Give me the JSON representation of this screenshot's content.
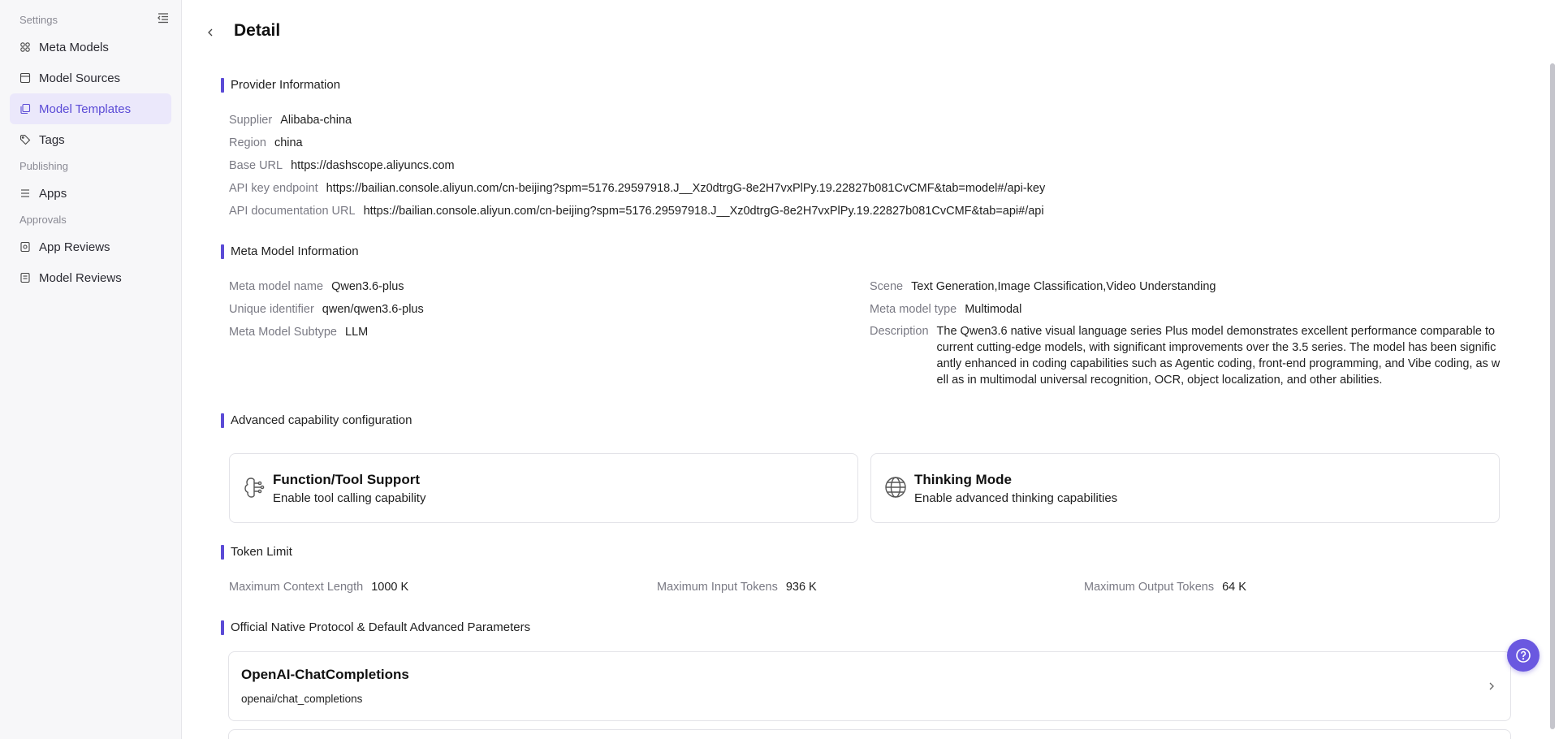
{
  "sidebar": {
    "settings_label": "Settings",
    "publishing_label": "Publishing",
    "approvals_label": "Approvals",
    "items": [
      {
        "label": "Meta Models",
        "icon": "meta-models-icon"
      },
      {
        "label": "Model Sources",
        "icon": "model-sources-icon"
      },
      {
        "label": "Model Templates",
        "icon": "model-templates-icon",
        "active": true
      },
      {
        "label": "Tags",
        "icon": "tag-icon"
      },
      {
        "label": "Apps",
        "icon": "apps-icon"
      },
      {
        "label": "App Reviews",
        "icon": "app-reviews-icon"
      },
      {
        "label": "Model Reviews",
        "icon": "model-reviews-icon"
      }
    ]
  },
  "header": {
    "title": "Detail"
  },
  "provider": {
    "section_title": "Provider Information",
    "supplier_label": "Supplier",
    "supplier": "Alibaba-china",
    "region_label": "Region",
    "region": "china",
    "base_url_label": "Base URL",
    "base_url": "https://dashscope.aliyuncs.com",
    "api_key_label": "API key endpoint",
    "api_key": "https://bailian.console.aliyun.com/cn-beijing?spm=5176.29597918.J__Xz0dtrgG-8e2H7vxPlPy.19.22827b081CvCMF&tab=model#/api-key",
    "api_doc_label": "API documentation URL",
    "api_doc": "https://bailian.console.aliyun.com/cn-beijing?spm=5176.29597918.J__Xz0dtrgG-8e2H7vxPlPy.19.22827b081CvCMF&tab=api#/api"
  },
  "meta_model": {
    "section_title": "Meta Model Information",
    "name_label": "Meta model name",
    "name": "Qwen3.6-plus",
    "uid_label": "Unique identifier",
    "uid": "qwen/qwen3.6-plus",
    "subtype_label": "Meta Model Subtype",
    "subtype": "LLM",
    "scene_label": "Scene",
    "scene": "Text Generation,Image Classification,Video Understanding",
    "type_label": "Meta model type",
    "type": "Multimodal",
    "desc_label": "Description",
    "desc": "The Qwen3.6 native visual language series Plus model demonstrates excellent performance comparable to current cutting-edge models, with significant improvements over the 3.5 series. The model has been significantly enhanced in coding capabilities such as Agentic coding, front-end programming, and Vibe coding, as well as in multimodal universal recognition, OCR, object localization, and other abilities."
  },
  "capabilities": {
    "section_title": "Advanced capability configuration",
    "tool_title": "Function/Tool Support",
    "tool_desc": "Enable tool calling capability",
    "thinking_title": "Thinking Mode",
    "thinking_desc": "Enable advanced thinking capabilities"
  },
  "tokens": {
    "section_title": "Token Limit",
    "ctx_label": "Maximum Context Length",
    "ctx": "1000 K",
    "input_label": "Maximum Input Tokens",
    "input": "936 K",
    "output_label": "Maximum Output Tokens",
    "output": "64 K"
  },
  "protocol": {
    "section_title": "Official Native Protocol & Default Advanced Parameters",
    "items": [
      {
        "title": "OpenAI-ChatCompletions",
        "sub": "openai/chat_completions"
      }
    ]
  },
  "colors": {
    "accent": "#5b4bd6",
    "active_bg": "#ebe8fb",
    "help_btn": "#6a58e0"
  }
}
